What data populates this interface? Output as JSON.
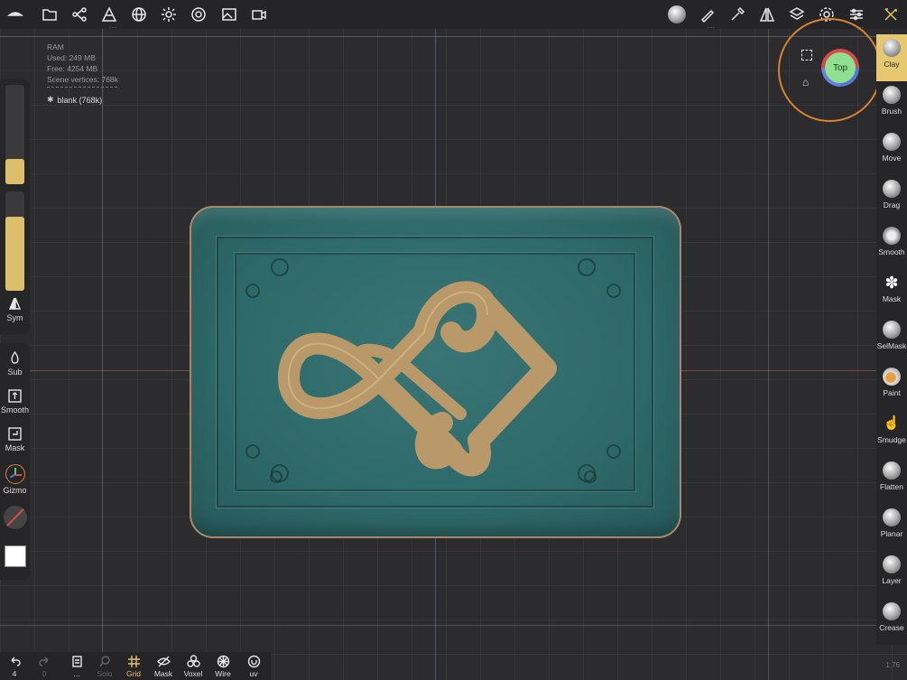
{
  "topbar": {
    "left_icons": [
      "menu-icon",
      "folder-icon",
      "scene-tree-icon",
      "topology-icon",
      "mesh-globe-icon",
      "light-icon",
      "camera-lens-icon",
      "image-icon",
      "video-icon"
    ],
    "right_icons": [
      "material-sphere-icon",
      "paint-brush-icon",
      "picker-icon",
      "symmetry-icon",
      "layers-icon",
      "settings-icon",
      "sliders-icon",
      "tools-icon"
    ]
  },
  "stats": {
    "ram": "RAM",
    "used": "Used: 249 MB",
    "free": "Free: 4254 MB",
    "vertices": "Scene vertices: 768k"
  },
  "scene": {
    "item": "blank (768k)"
  },
  "gizmo": {
    "view_label": "Top"
  },
  "left_tools": {
    "sym": "Sym",
    "sub": "Sub",
    "smooth": "Smooth",
    "mask": "Mask",
    "gizmo": "Gizmo"
  },
  "right_tools": [
    {
      "label": "Clay",
      "active": true
    },
    {
      "label": "Brush"
    },
    {
      "label": "Move"
    },
    {
      "label": "Drag"
    },
    {
      "label": "Smooth"
    },
    {
      "label": "Mask"
    },
    {
      "label": "SelMask"
    },
    {
      "label": "Paint"
    },
    {
      "label": "Smudge"
    },
    {
      "label": "Flatten"
    },
    {
      "label": "Planar"
    },
    {
      "label": "Layer"
    },
    {
      "label": "Crease"
    }
  ],
  "bottom": {
    "undo_count": "4",
    "redo_count": "0",
    "more": "...",
    "solo": "Solo",
    "grid": "Grid",
    "mask": "Mask",
    "voxel": "Voxel",
    "wire": "Wire",
    "uv": "uv"
  },
  "version": "1.76",
  "colors": {
    "accent": "#e6c06a",
    "model": "#2f6a6a",
    "gold": "#b9996a",
    "gizmo_ring": "#d8812f",
    "gizmo_face": "#8fe08f"
  }
}
